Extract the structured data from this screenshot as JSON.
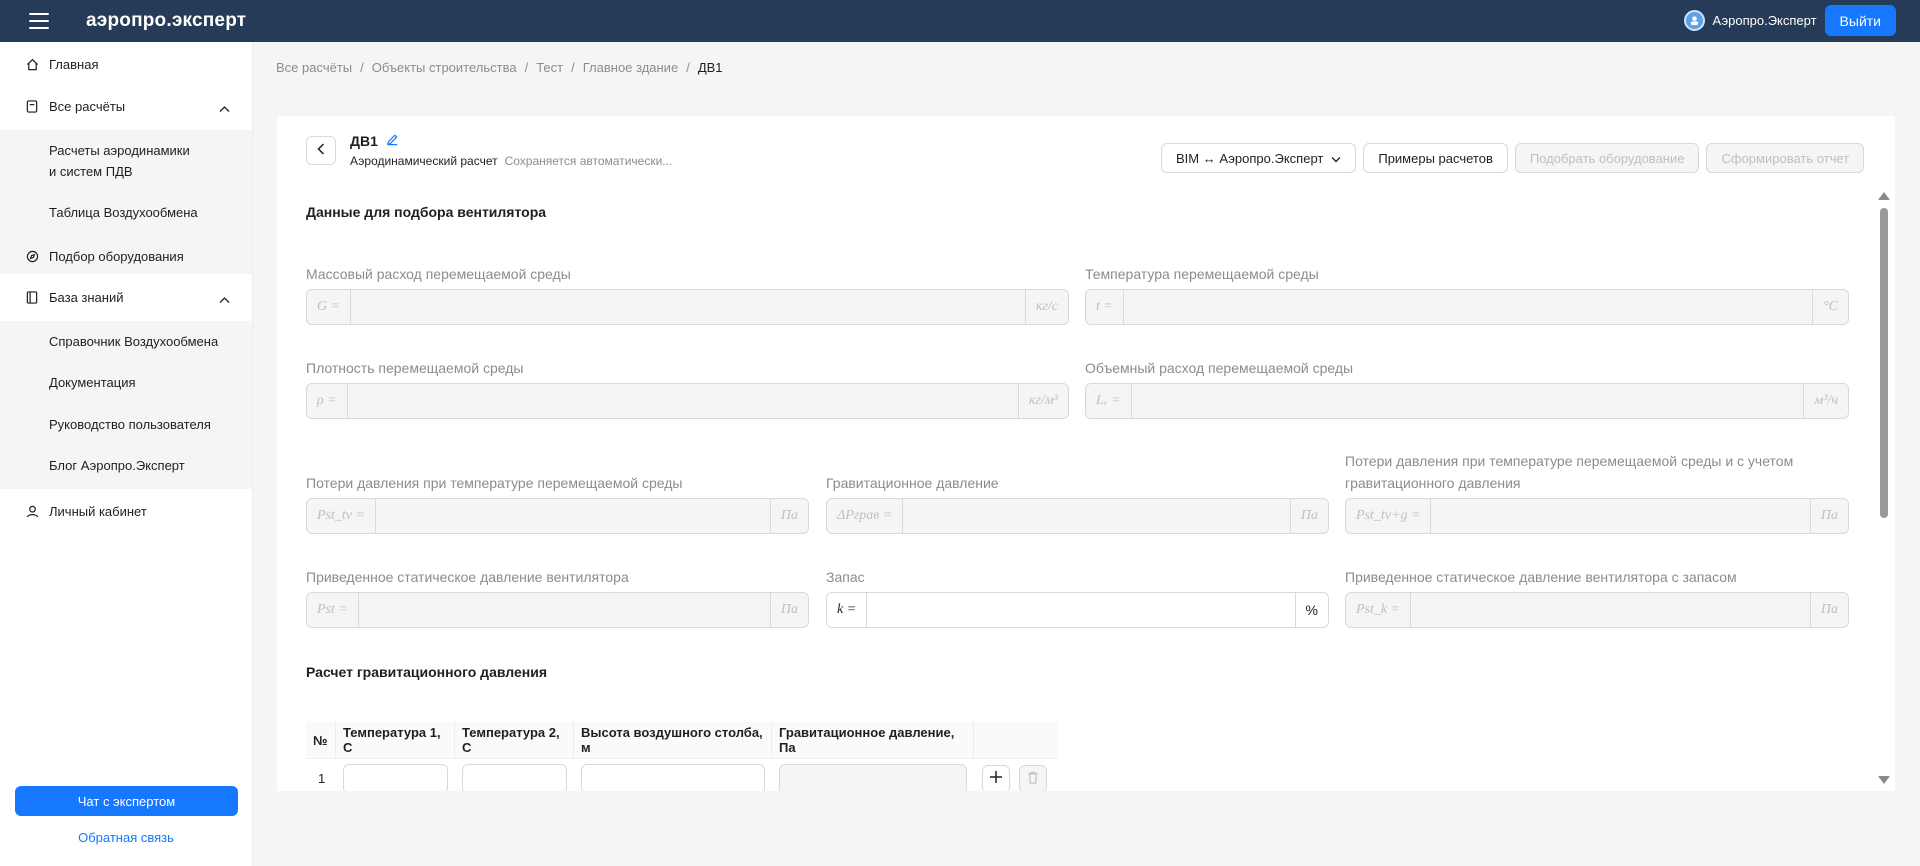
{
  "header": {
    "logo": "аэропро.эксперт",
    "user_name": "Аэропро.Эксперт",
    "logout_label": "Выйти"
  },
  "sidebar": {
    "items": [
      {
        "label": "Главная",
        "icon": "home-icon"
      },
      {
        "label": "Все расчёты",
        "icon": "calculator-icon",
        "expanded": true
      },
      {
        "label": "Подбор оборудования",
        "icon": "compass-icon"
      },
      {
        "label": "База знаний",
        "icon": "book-icon",
        "expanded": true
      },
      {
        "label": "Личный кабинет",
        "icon": "user-icon"
      }
    ],
    "calc_sub": [
      "Расчеты аэродинамики",
      "и систем ПДВ",
      "Таблица Воздухообмена"
    ],
    "kb_sub": [
      "Справочник Воздухообмена",
      "Документация",
      "Руководство пользователя",
      "Блог Аэропро.Эксперт"
    ],
    "chat_label": "Чат с экспертом",
    "feedback_label": "Обратная связь"
  },
  "breadcrumb": [
    "Все расчёты",
    "Объекты строительства",
    "Тест",
    "Главное здание",
    "ДВ1"
  ],
  "calc": {
    "title": "ДВ1",
    "type": "Аэродинамический расчет",
    "status": "Сохраняется автоматически..."
  },
  "toolbar": {
    "bim_label": "BIM ↔ Аэропро.Эксперт",
    "examples_label": "Примеры расчетов",
    "select_equipment_label": "Подобрать оборудование",
    "report_label": "Сформировать отчет"
  },
  "section1_title": "Данные для подбора вентилятора",
  "fields": {
    "mass_flow": {
      "label": "Массовый расход перемещаемой среды",
      "prefix": "G =",
      "unit": "кг/с",
      "value": ""
    },
    "temperature": {
      "label": "Температура перемещаемой среды",
      "prefix": "t =",
      "unit": "°C",
      "value": ""
    },
    "density": {
      "label": "Плотность перемещаемой среды",
      "prefix": "ρ =",
      "unit": "кг/м³",
      "value": ""
    },
    "volume_flow": {
      "label": "Объемный расход перемещаемой среды",
      "prefix": "Lᵥ =",
      "unit": "м³/ч",
      "value": ""
    },
    "pressure_loss": {
      "label": "Потери давления при температуре перемещаемой среды",
      "prefix": "Pst_tv =",
      "unit": "Па",
      "value": ""
    },
    "gravity_pressure": {
      "label": "Гравитационное давление",
      "prefix": "ΔPграв =",
      "unit": "Па",
      "value": ""
    },
    "pressure_loss_grav": {
      "label_line1": "Потери давления при температуре перемещаемой среды и с учетом",
      "label_line2": "гравитационного давления",
      "prefix": "Pst_tv+g =",
      "unit": "Па",
      "value": ""
    },
    "static_pressure": {
      "label": "Приведенное статическое давление вентилятора",
      "prefix": "Pst =",
      "unit": "Па",
      "value": ""
    },
    "reserve": {
      "label": "Запас",
      "prefix": "k =",
      "unit": "%",
      "value": ""
    },
    "static_pressure_reserve": {
      "label": "Приведенное статическое давление вентилятора с запасом",
      "prefix": "Pst_k =",
      "unit": "Па",
      "value": ""
    }
  },
  "section2_title": "Расчет гравитационного давления",
  "table": {
    "headers": [
      "№",
      "Температура 1, С",
      "Температура 2, С",
      "Высота воздушного столба, м",
      "Гравитационное давление, Па"
    ],
    "rows": [
      {
        "num": "1",
        "t1": "",
        "t2": "",
        "height": "",
        "pressure": ""
      }
    ]
  }
}
